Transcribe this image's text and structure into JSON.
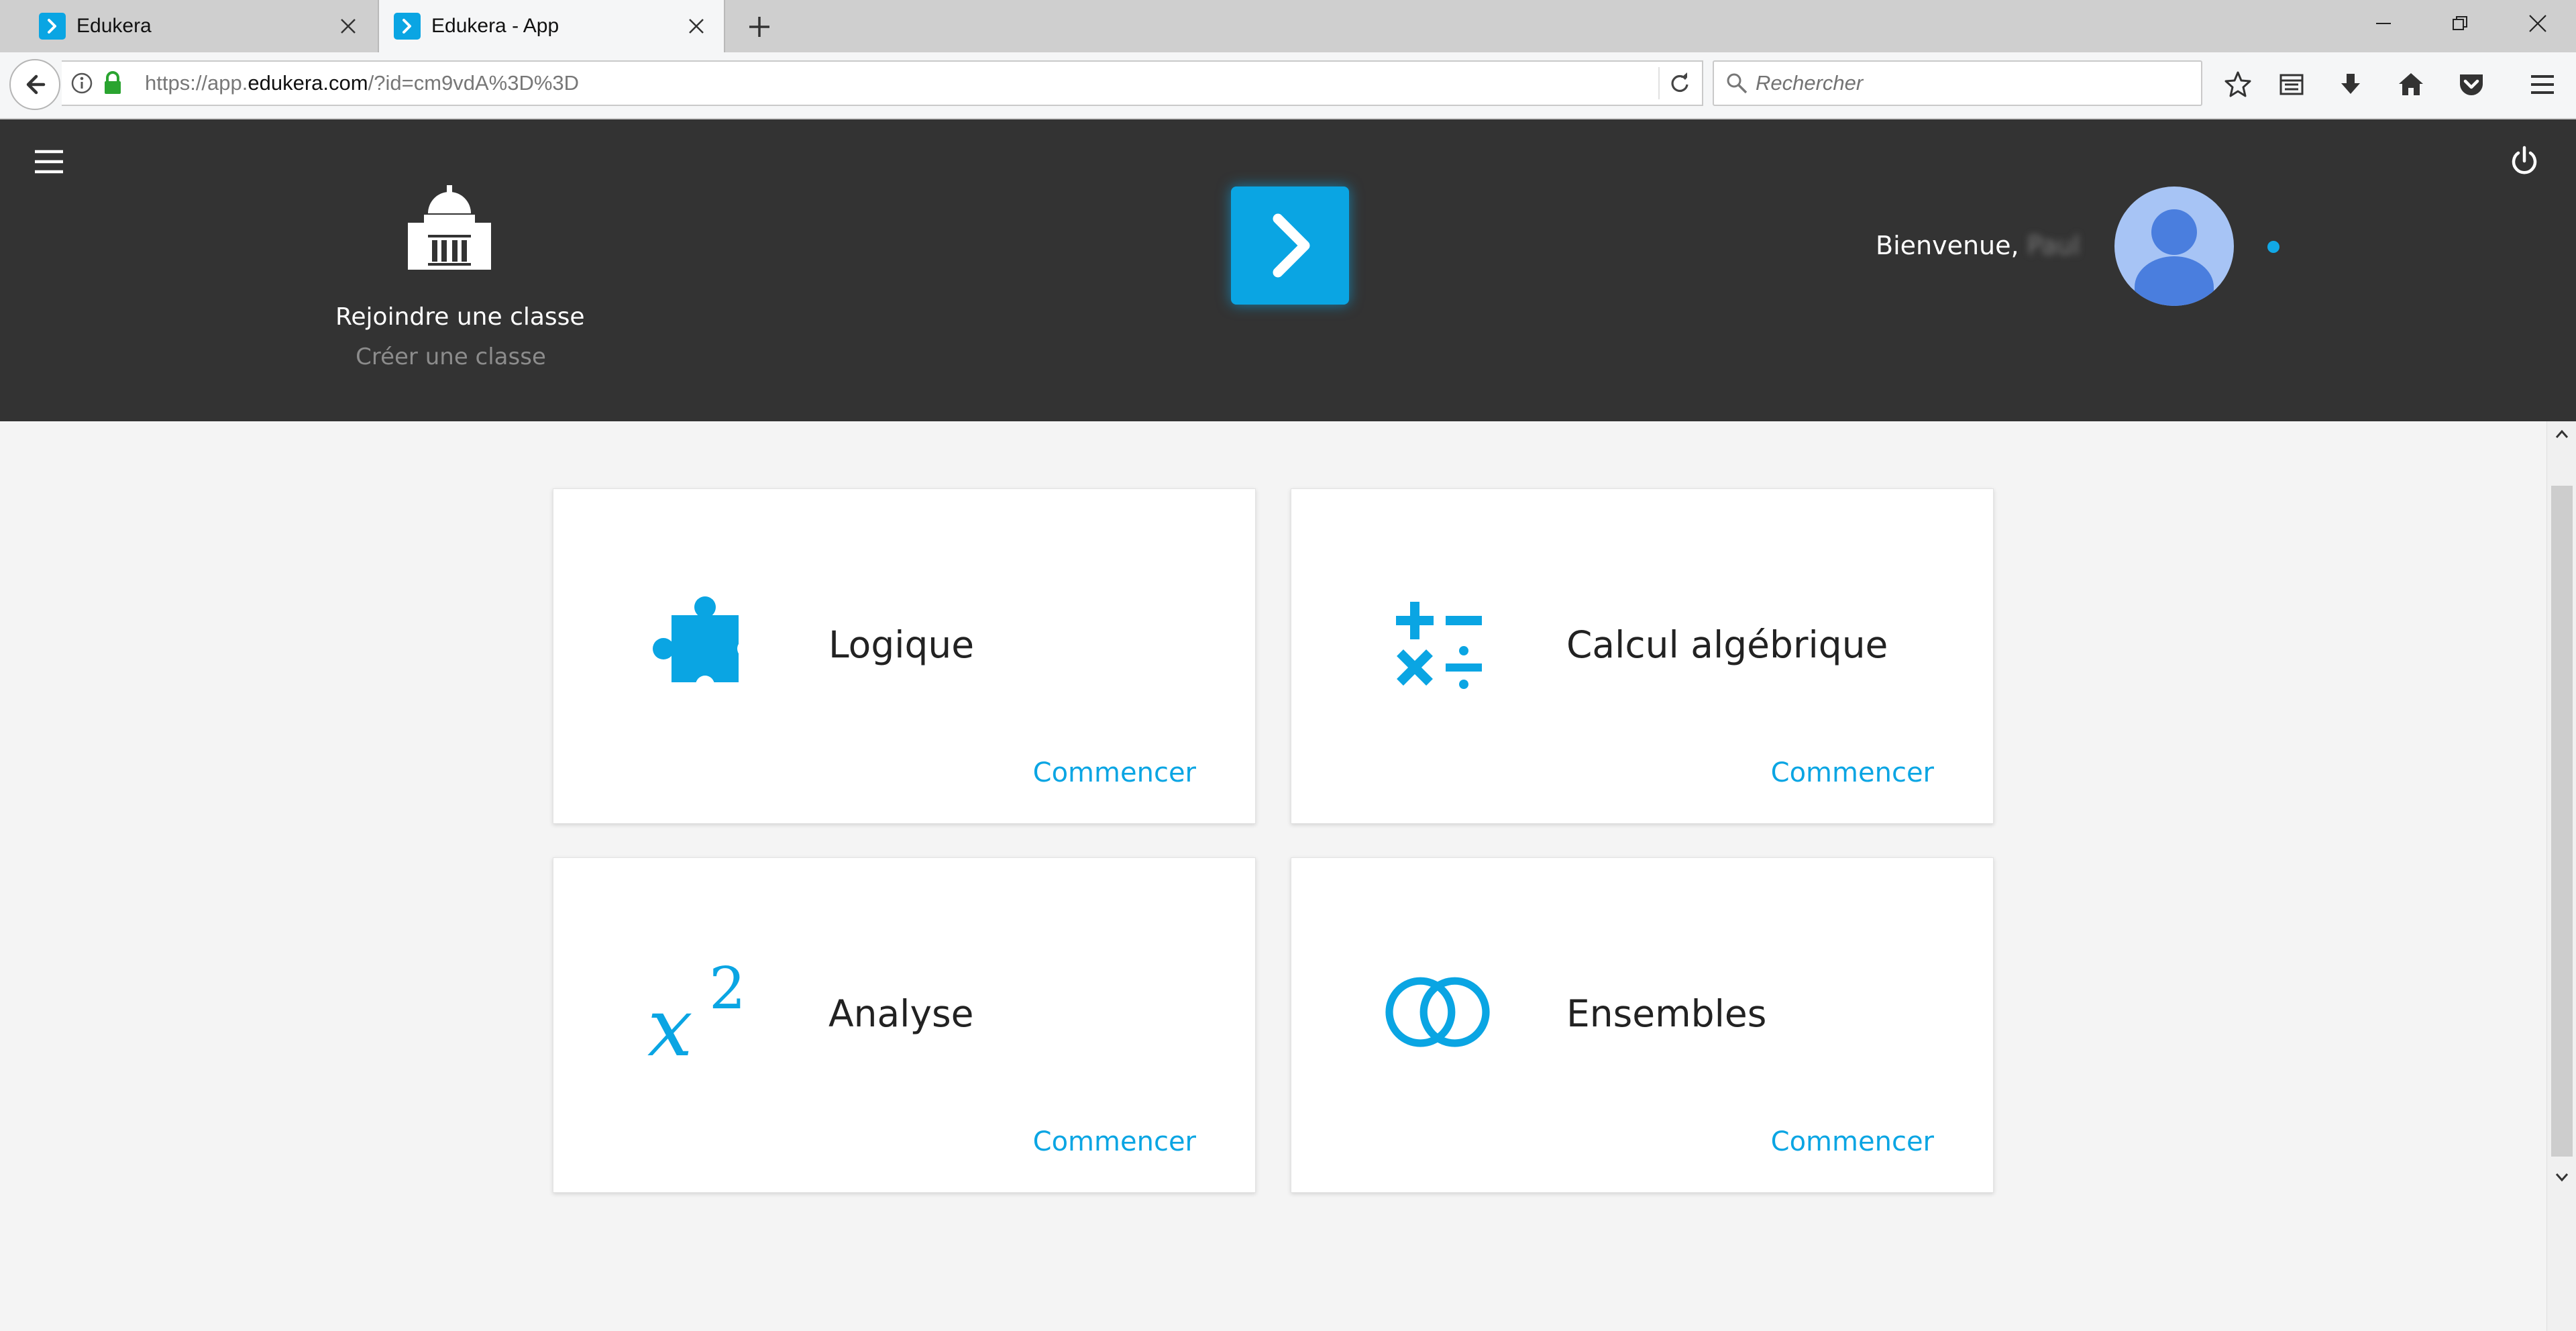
{
  "browser": {
    "tabs": [
      {
        "title": "Edukera",
        "active": false
      },
      {
        "title": "Edukera - App",
        "active": true
      }
    ],
    "url": {
      "prefix": "https://app.",
      "host": "edukera.com",
      "path": "/?id=cm9vdA%3D%3D"
    },
    "search_placeholder": "Rechercher"
  },
  "header": {
    "join_class": "Rejoindre une classe",
    "create_class": "Créer une classe",
    "welcome": "Bienvenue,",
    "user_name": "Paul"
  },
  "cards": [
    {
      "title": "Logique",
      "action": "Commencer",
      "icon": "puzzle-icon"
    },
    {
      "title": "Calcul algébrique",
      "action": "Commencer",
      "icon": "math-operators-icon"
    },
    {
      "title": "Analyse",
      "action": "Commencer",
      "icon": "x-squared-icon"
    },
    {
      "title": "Ensembles",
      "action": "Commencer",
      "icon": "sets-icon"
    }
  ],
  "colors": {
    "accent": "#0aa5e3",
    "header_bg": "#333333",
    "page_bg": "#f4f4f4"
  }
}
